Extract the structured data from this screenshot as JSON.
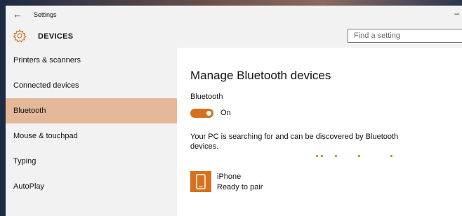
{
  "window": {
    "title": "Settings",
    "back_icon": "back-arrow-icon",
    "minimize_icon": "minimize-icon"
  },
  "header": {
    "icon": "gear-icon",
    "section": "DEVICES",
    "search_placeholder": "Find a setting"
  },
  "sidebar": {
    "items": [
      {
        "label": "Printers & scanners"
      },
      {
        "label": "Connected devices"
      },
      {
        "label": "Bluetooth",
        "active": true
      },
      {
        "label": "Mouse & touchpad"
      },
      {
        "label": "Typing"
      },
      {
        "label": "AutoPlay"
      }
    ]
  },
  "main": {
    "title": "Manage Bluetooth devices",
    "bluetooth_label": "Bluetooth",
    "toggle_state": "On",
    "toggle_on": true,
    "status": "Your PC is searching for and can be discovered by Bluetooth devices.",
    "devices": [
      {
        "name": "iPhone",
        "state": "Ready to pair",
        "icon": "phone-icon"
      }
    ]
  },
  "colors": {
    "accent": "#d6721f",
    "active_item": "#e4b898",
    "sidebar_bg": "#f2f2f2"
  }
}
